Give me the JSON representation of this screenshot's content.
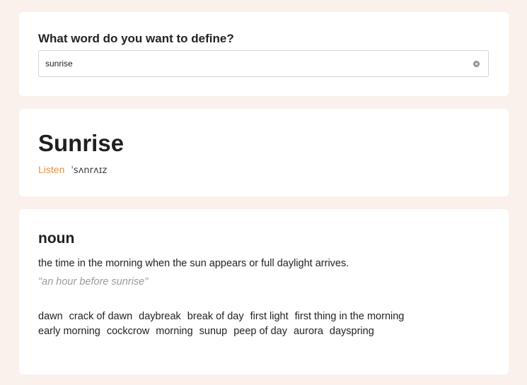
{
  "search": {
    "question": "What word do you want to define?",
    "value": "sunrise"
  },
  "word": {
    "title": "Sunrise",
    "listen_label": "Listen",
    "phonetic": "ˈsʌnrʌɪz"
  },
  "meaning": {
    "part_of_speech": "noun",
    "definition": "the time in the morning when the sun appears or full daylight arrives.",
    "example": "\"an hour before sunrise\"",
    "synonyms": [
      "dawn",
      "crack of dawn",
      "daybreak",
      "break of day",
      "first light",
      "first thing in the morning",
      "early morning",
      "cockcrow",
      "morning",
      "sunup",
      "peep of day",
      "aurora",
      "dayspring"
    ]
  },
  "colors": {
    "background": "#fbf1ec",
    "card": "#ffffff",
    "accent": "#e8923f",
    "muted": "#9b9ba0"
  },
  "icons": {
    "clear": "clear-icon"
  }
}
